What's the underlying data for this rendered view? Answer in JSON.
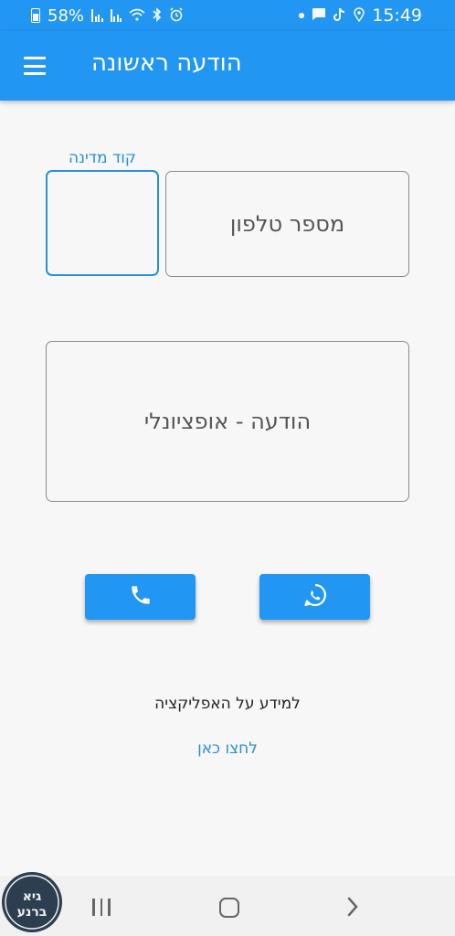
{
  "status_bar": {
    "battery": "58%",
    "time": "15:49"
  },
  "app_bar": {
    "title": "הודעה ראשונה"
  },
  "form": {
    "country_code_label": "קוד מדינה",
    "phone_placeholder": "מספר טלפון",
    "message_placeholder": "הודעה - אופציונלי"
  },
  "buttons": {
    "call_icon": "phone-icon",
    "whatsapp_icon": "whatsapp-icon"
  },
  "info": {
    "text": "למידע על האפליקציה",
    "link": "לחצו כאן"
  },
  "watermark": {
    "text": "גיא ברנע"
  },
  "colors": {
    "primary": "#2196f3",
    "accent": "#2a8fd8",
    "background": "#f7f7f7"
  }
}
